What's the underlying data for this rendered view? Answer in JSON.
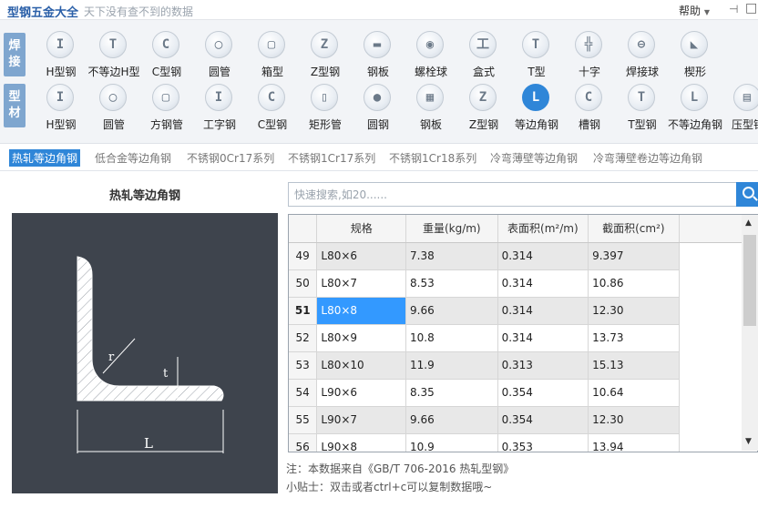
{
  "app": {
    "title": "型钢五金大全",
    "slogan": "天下没有查不到的数据",
    "help": "帮助",
    "help_caret": "▼",
    "pin_icon": "⊣",
    "min_icon": "□"
  },
  "toolbar": {
    "row1_label": "焊\n接",
    "row2_label": "型\n材",
    "row1": [
      {
        "label": "H型钢",
        "icon": "I"
      },
      {
        "label": "不等边H型",
        "icon": "T"
      },
      {
        "label": "C型钢",
        "icon": "C"
      },
      {
        "label": "圆管",
        "icon": "◯"
      },
      {
        "label": "箱型",
        "icon": "▢"
      },
      {
        "label": "Z型钢",
        "icon": "Z"
      },
      {
        "label": "钢板",
        "icon": "▬"
      },
      {
        "label": "螺栓球",
        "icon": "◉"
      },
      {
        "label": "盒式",
        "icon": "工"
      },
      {
        "label": "T型",
        "icon": "T"
      },
      {
        "label": "十字",
        "icon": "╬"
      },
      {
        "label": "焊接球",
        "icon": "⊖"
      },
      {
        "label": "楔形",
        "icon": "◣"
      }
    ],
    "row2": [
      {
        "label": "H型钢",
        "icon": "I"
      },
      {
        "label": "圆管",
        "icon": "◯"
      },
      {
        "label": "方钢管",
        "icon": "▢"
      },
      {
        "label": "工字钢",
        "icon": "I"
      },
      {
        "label": "C型钢",
        "icon": "C"
      },
      {
        "label": "矩形管",
        "icon": "▯"
      },
      {
        "label": "圆钢",
        "icon": "●"
      },
      {
        "label": "钢板",
        "icon": "▦"
      },
      {
        "label": "Z型钢",
        "icon": "Z"
      },
      {
        "label": "等边角钢",
        "icon": "L",
        "selected": true
      },
      {
        "label": "槽钢",
        "icon": "C"
      },
      {
        "label": "T型钢",
        "icon": "T"
      },
      {
        "label": "不等边角钢",
        "icon": "L"
      },
      {
        "label": "压型钢",
        "icon": "▤"
      }
    ]
  },
  "tabs": [
    {
      "label": "热轧等边角钢",
      "active": true
    },
    {
      "label": "低合金等边角钢"
    },
    {
      "label": "不锈钢0Cr17系列"
    },
    {
      "label": "不锈钢1Cr17系列"
    },
    {
      "label": "不锈钢1Cr18系列"
    },
    {
      "label": "冷弯薄壁等边角钢"
    },
    {
      "label": "冷弯薄壁卷边等边角钢"
    }
  ],
  "diagram": {
    "title": "热轧等边角钢",
    "label_r": "r",
    "label_t": "t",
    "label_L": "L"
  },
  "search": {
    "placeholder": "快速搜索,如20......"
  },
  "grid": {
    "columns": [
      "规格",
      "重量(kg/m)",
      "表面积(m²/m)",
      "截面积(cm²)"
    ],
    "rows": [
      {
        "n": "49",
        "cells": [
          "L80×6",
          "7.38",
          "0.314",
          "9.397"
        ]
      },
      {
        "n": "50",
        "cells": [
          "L80×7",
          "8.53",
          "0.314",
          "10.86"
        ]
      },
      {
        "n": "51",
        "cells": [
          "L80×8",
          "9.66",
          "0.314",
          "12.30"
        ],
        "selected": true
      },
      {
        "n": "52",
        "cells": [
          "L80×9",
          "10.8",
          "0.314",
          "13.73"
        ]
      },
      {
        "n": "53",
        "cells": [
          "L80×10",
          "11.9",
          "0.313",
          "15.13"
        ]
      },
      {
        "n": "54",
        "cells": [
          "L90×6",
          "8.35",
          "0.354",
          "10.64"
        ]
      },
      {
        "n": "55",
        "cells": [
          "L90×7",
          "9.66",
          "0.354",
          "12.30"
        ]
      },
      {
        "n": "56",
        "cells": [
          "L90×8",
          "10.9",
          "0.353",
          "13.94"
        ]
      }
    ]
  },
  "footer": {
    "note": "注：本数据来自《GB/T 706-2016 热轧型钢》",
    "tip": "小贴士：双击或者ctrl+c可以复制数据哦~"
  },
  "colors": {
    "accent": "#2f86d8",
    "diagram_bg": "#3e444d"
  }
}
